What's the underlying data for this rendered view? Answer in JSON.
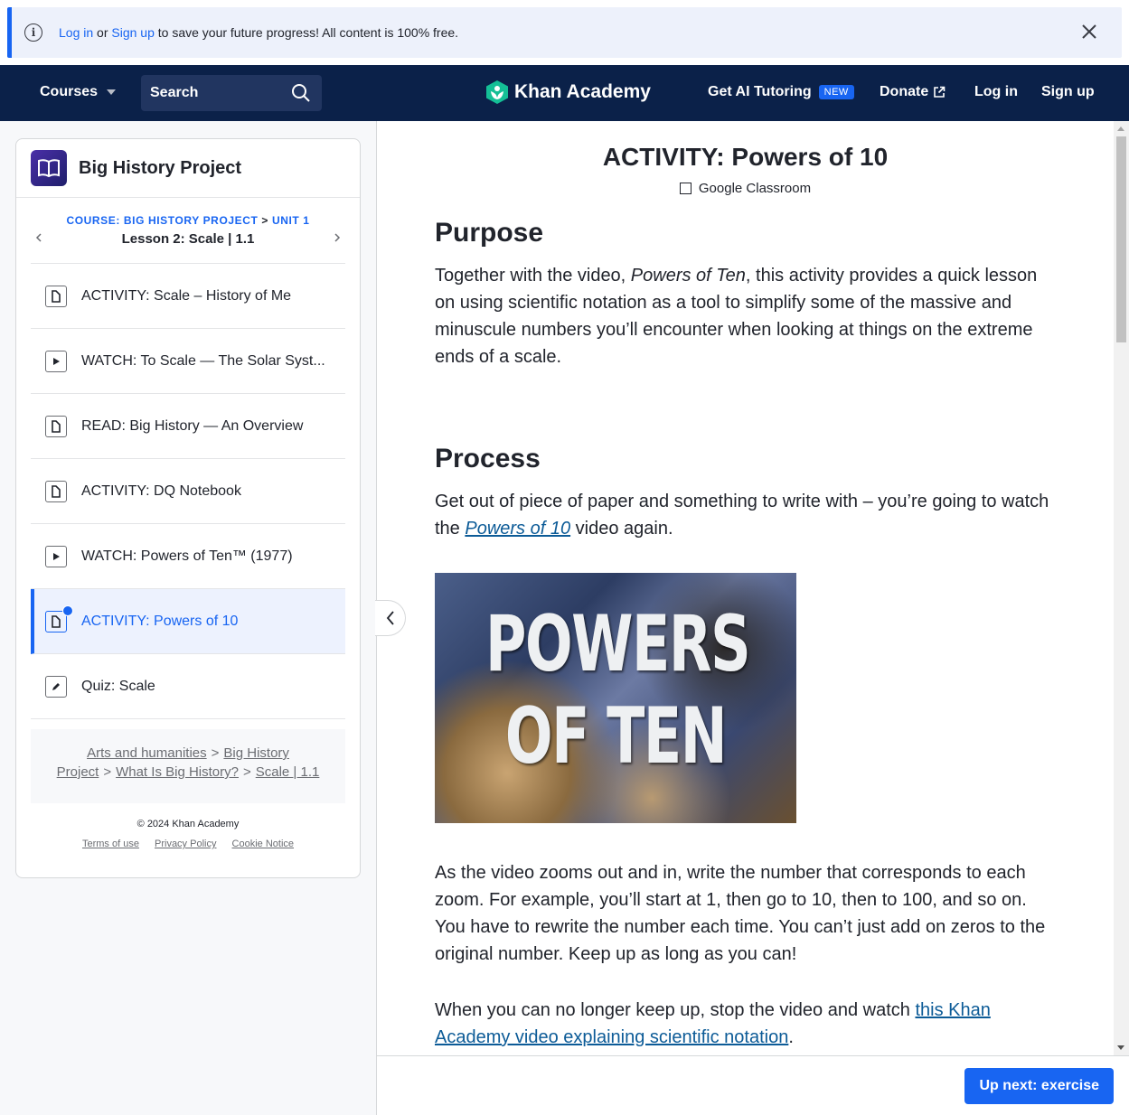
{
  "banner": {
    "login": "Log in",
    "or": " or ",
    "signup": "Sign up",
    "rest": " to save your future progress! All content is 100% free."
  },
  "nav": {
    "courses": "Courses",
    "search_label": "Search",
    "logo": "Khan Academy",
    "ai_tutoring": "Get AI Tutoring",
    "new_badge": "NEW",
    "donate": "Donate",
    "login": "Log in",
    "signup": "Sign up"
  },
  "sidebar": {
    "course_title": "Big History Project",
    "crumb_course": "COURSE: BIG HISTORY PROJECT",
    "crumb_sep": " > ",
    "crumb_unit": "UNIT 1",
    "lesson": "Lesson 2: Scale | 1.1",
    "items": [
      {
        "label": "ACTIVITY: Scale – History of Me",
        "icon": "article-icon"
      },
      {
        "label": "WATCH: To Scale — The Solar Syst...",
        "icon": "play-icon"
      },
      {
        "label": "READ: Big History — An Overview",
        "icon": "article-icon"
      },
      {
        "label": "ACTIVITY: DQ Notebook",
        "icon": "article-icon"
      },
      {
        "label": "WATCH: Powers of Ten™ (1977)",
        "icon": "play-icon"
      },
      {
        "label": "ACTIVITY: Powers of 10",
        "icon": "article-icon",
        "active": true
      },
      {
        "label": "Quiz: Scale",
        "icon": "pencil-icon"
      }
    ],
    "breadcrumbs": {
      "b1": "Arts and humanities",
      "b2": "Big History Project",
      "b3": "What Is Big History?",
      "b4": "Scale | 1.1",
      "sep": ">"
    },
    "copyright": "© 2024 Khan Academy",
    "terms": "Terms of use",
    "privacy": "Privacy Policy",
    "cookie": "Cookie Notice"
  },
  "main": {
    "title": "ACTIVITY: Powers of 10",
    "google_classroom": "Google Classroom",
    "purpose_heading": "Purpose",
    "purpose_1": "Together with the video, ",
    "purpose_italic": "Powers of Ten",
    "purpose_2": ", this activity provides a quick lesson on using scientific notation as a tool to simplify some of the massive and minuscule numbers you’ll encounter when looking at things on the extreme ends of a scale.",
    "process_heading": "Process",
    "process_1": "Get out of piece of paper and something to write with – you’re going to watch the ",
    "process_link": "Powers of 10",
    "process_2": " video again.",
    "video_line1": "POWERS",
    "video_line2": "OF TEN",
    "para_zoom": "As the video zooms out and in, write the number that corresponds to each zoom. For example, you’ll start at 1, then go to 10, then to 100, and so on. You have to rewrite the number each time. You can’t just add on zeros to the original number. Keep up as long as you can!",
    "para_stop_1": "When you can no longer keep up, stop the video and watch ",
    "para_stop_link": "this Khan Academy video explaining scientific notation",
    "para_stop_2": "."
  },
  "footer": {
    "up_next": "Up next: exercise"
  },
  "colors": {
    "brand_blue": "#1865f2",
    "nav_bg": "#0b2149",
    "khan_green": "#14bf96"
  }
}
